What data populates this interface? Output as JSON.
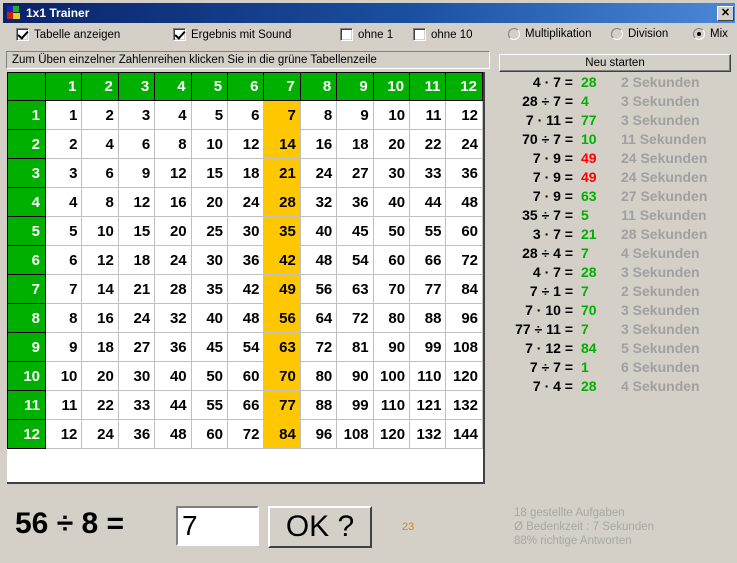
{
  "window": {
    "title": "1x1 Trainer",
    "close_label": "✕",
    "icon": "puzzle-icon"
  },
  "options": {
    "show_table": {
      "label": "Tabelle anzeigen",
      "checked": true
    },
    "sound": {
      "label": "Ergebnis mit Sound",
      "checked": true
    },
    "without_1": {
      "label": "ohne 1",
      "checked": false
    },
    "without_10": {
      "label": "ohne 10",
      "checked": false
    },
    "mode_multiplication": {
      "label": "Multiplikation",
      "checked": false
    },
    "mode_division": {
      "label": "Division",
      "checked": false
    },
    "mode_mix": {
      "label": "Mix",
      "checked": true
    }
  },
  "hint": "Zum Üben einzelner Zahlenreihen klicken Sie in die grüne Tabellenzeile",
  "table": {
    "headers": [
      "1",
      "2",
      "3",
      "4",
      "5",
      "6",
      "7",
      "8",
      "9",
      "10",
      "11",
      "12"
    ],
    "highlight_column": 7,
    "rows": [
      {
        "header": "1",
        "cells": [
          "1",
          "2",
          "3",
          "4",
          "5",
          "6",
          "7",
          "8",
          "9",
          "10",
          "11",
          "12"
        ]
      },
      {
        "header": "2",
        "cells": [
          "2",
          "4",
          "6",
          "8",
          "10",
          "12",
          "14",
          "16",
          "18",
          "20",
          "22",
          "24"
        ]
      },
      {
        "header": "3",
        "cells": [
          "3",
          "6",
          "9",
          "12",
          "15",
          "18",
          "21",
          "24",
          "27",
          "30",
          "33",
          "36"
        ]
      },
      {
        "header": "4",
        "cells": [
          "4",
          "8",
          "12",
          "16",
          "20",
          "24",
          "28",
          "32",
          "36",
          "40",
          "44",
          "48"
        ]
      },
      {
        "header": "5",
        "cells": [
          "5",
          "10",
          "15",
          "20",
          "25",
          "30",
          "35",
          "40",
          "45",
          "50",
          "55",
          "60"
        ]
      },
      {
        "header": "6",
        "cells": [
          "6",
          "12",
          "18",
          "24",
          "30",
          "36",
          "42",
          "48",
          "54",
          "60",
          "66",
          "72"
        ]
      },
      {
        "header": "7",
        "cells": [
          "7",
          "14",
          "21",
          "28",
          "35",
          "42",
          "49",
          "56",
          "63",
          "70",
          "77",
          "84"
        ]
      },
      {
        "header": "8",
        "cells": [
          "8",
          "16",
          "24",
          "32",
          "40",
          "48",
          "56",
          "64",
          "72",
          "80",
          "88",
          "96"
        ]
      },
      {
        "header": "9",
        "cells": [
          "9",
          "18",
          "27",
          "36",
          "45",
          "54",
          "63",
          "72",
          "81",
          "90",
          "99",
          "108"
        ]
      },
      {
        "header": "10",
        "cells": [
          "10",
          "20",
          "30",
          "40",
          "50",
          "60",
          "70",
          "80",
          "90",
          "100",
          "110",
          "120"
        ]
      },
      {
        "header": "11",
        "cells": [
          "11",
          "22",
          "33",
          "44",
          "55",
          "66",
          "77",
          "88",
          "99",
          "110",
          "121",
          "132"
        ]
      },
      {
        "header": "12",
        "cells": [
          "12",
          "24",
          "36",
          "48",
          "60",
          "72",
          "84",
          "96",
          "108",
          "120",
          "132",
          "144"
        ]
      }
    ]
  },
  "colors": {
    "header_green": "#00b000",
    "highlight_yellow": "#ffc700",
    "correct_green": "#00b000",
    "wrong_red": "#ff0000",
    "time_gray": "#a0a0a0",
    "counter_orange": "#e08020"
  },
  "restart_button": "Neu starten",
  "results": [
    {
      "question": "4 · 7 =",
      "answer": "28",
      "correct": true,
      "time": "2 Sekunden"
    },
    {
      "question": "28 ÷ 7 =",
      "answer": "4",
      "correct": true,
      "time": "3 Sekunden"
    },
    {
      "question": "7 · 11 =",
      "answer": "77",
      "correct": true,
      "time": "3 Sekunden"
    },
    {
      "question": "70 ÷ 7 =",
      "answer": "10",
      "correct": true,
      "time": "11 Sekunden"
    },
    {
      "question": "7 · 9 =",
      "answer": "49",
      "correct": false,
      "time": "24 Sekunden"
    },
    {
      "question": "7 · 9 =",
      "answer": "49",
      "correct": false,
      "time": "24 Sekunden"
    },
    {
      "question": "7 · 9 =",
      "answer": "63",
      "correct": true,
      "time": "27 Sekunden"
    },
    {
      "question": "35 ÷ 7 =",
      "answer": "5",
      "correct": true,
      "time": "11 Sekunden"
    },
    {
      "question": "3 · 7 =",
      "answer": "21",
      "correct": true,
      "time": "28 Sekunden"
    },
    {
      "question": "28 ÷ 4 =",
      "answer": "7",
      "correct": true,
      "time": "4 Sekunden"
    },
    {
      "question": "4 · 7 =",
      "answer": "28",
      "correct": true,
      "time": "3 Sekunden"
    },
    {
      "question": "7 ÷ 1 =",
      "answer": "7",
      "correct": true,
      "time": "2 Sekunden"
    },
    {
      "question": "7 · 10 =",
      "answer": "70",
      "correct": true,
      "time": "3 Sekunden"
    },
    {
      "question": "77 ÷ 11 =",
      "answer": "7",
      "correct": true,
      "time": "3 Sekunden"
    },
    {
      "question": "7 · 12 =",
      "answer": "84",
      "correct": true,
      "time": "5 Sekunden"
    },
    {
      "question": "7 ÷ 7 =",
      "answer": "1",
      "correct": true,
      "time": "6 Sekunden"
    },
    {
      "question": "7 · 4 =",
      "answer": "28",
      "correct": true,
      "time": "4 Sekunden"
    }
  ],
  "current": {
    "question": "56 ÷ 8 =",
    "input_value": "7",
    "input_placeholder": "",
    "ok_label": "OK ?",
    "counter": "23"
  },
  "stats": {
    "line1": "18 gestellte Aufgaben",
    "line2": "Ø Bedenkzeit : 7 Sekunden",
    "line3": "88% richtige Antworten"
  }
}
